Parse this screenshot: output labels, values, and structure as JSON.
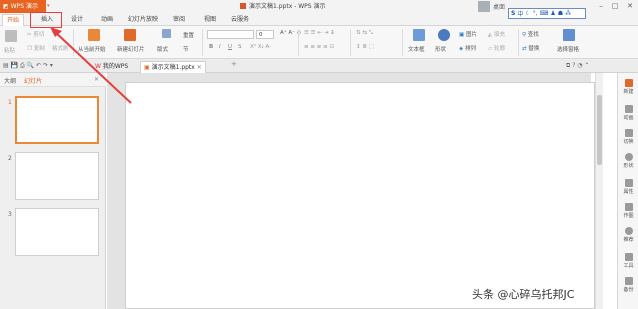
{
  "app": {
    "menu_button": "WPS 演示",
    "window_title": "演示文稿1.pptx - WPS 演示",
    "user_name": "桌面",
    "ime_status": "中"
  },
  "menu_tabs": [
    "开始",
    "插入",
    "设计",
    "动画",
    "幻灯片放映",
    "审阅",
    "视图",
    "云服务"
  ],
  "ribbon": {
    "paste": "粘贴",
    "cut": "剪切",
    "copy": "复制",
    "format_painter": "格式刷",
    "from_current": "从当前开始",
    "new_slide": "新建幻灯片",
    "layout": "版式",
    "section": "节",
    "reset": "重置",
    "font_size": "0",
    "text_box": "文本框",
    "shape": "形状",
    "picture": "图片",
    "fill": "填充",
    "outline": "轮廓",
    "arrange": "排列",
    "find": "查找",
    "replace": "替换",
    "select_pane": "选择窗格"
  },
  "doc_tabs": {
    "home": "我的WPS",
    "file": "演示文稿1.pptx"
  },
  "left_panel": {
    "outline_tab": "大纲",
    "slides_tab": "幻灯片",
    "slides": [
      {
        "num": "1"
      },
      {
        "num": "2"
      },
      {
        "num": "3"
      }
    ]
  },
  "sidebar": {
    "items": [
      "新建",
      "动画",
      "切换",
      "形状",
      "属性",
      "作图",
      "推荐",
      "工具",
      "备份"
    ]
  },
  "watermark": "头条 @心碎乌托邦JC",
  "colors": {
    "accent": "#e86420",
    "highlight_box": "#e53e3e"
  }
}
